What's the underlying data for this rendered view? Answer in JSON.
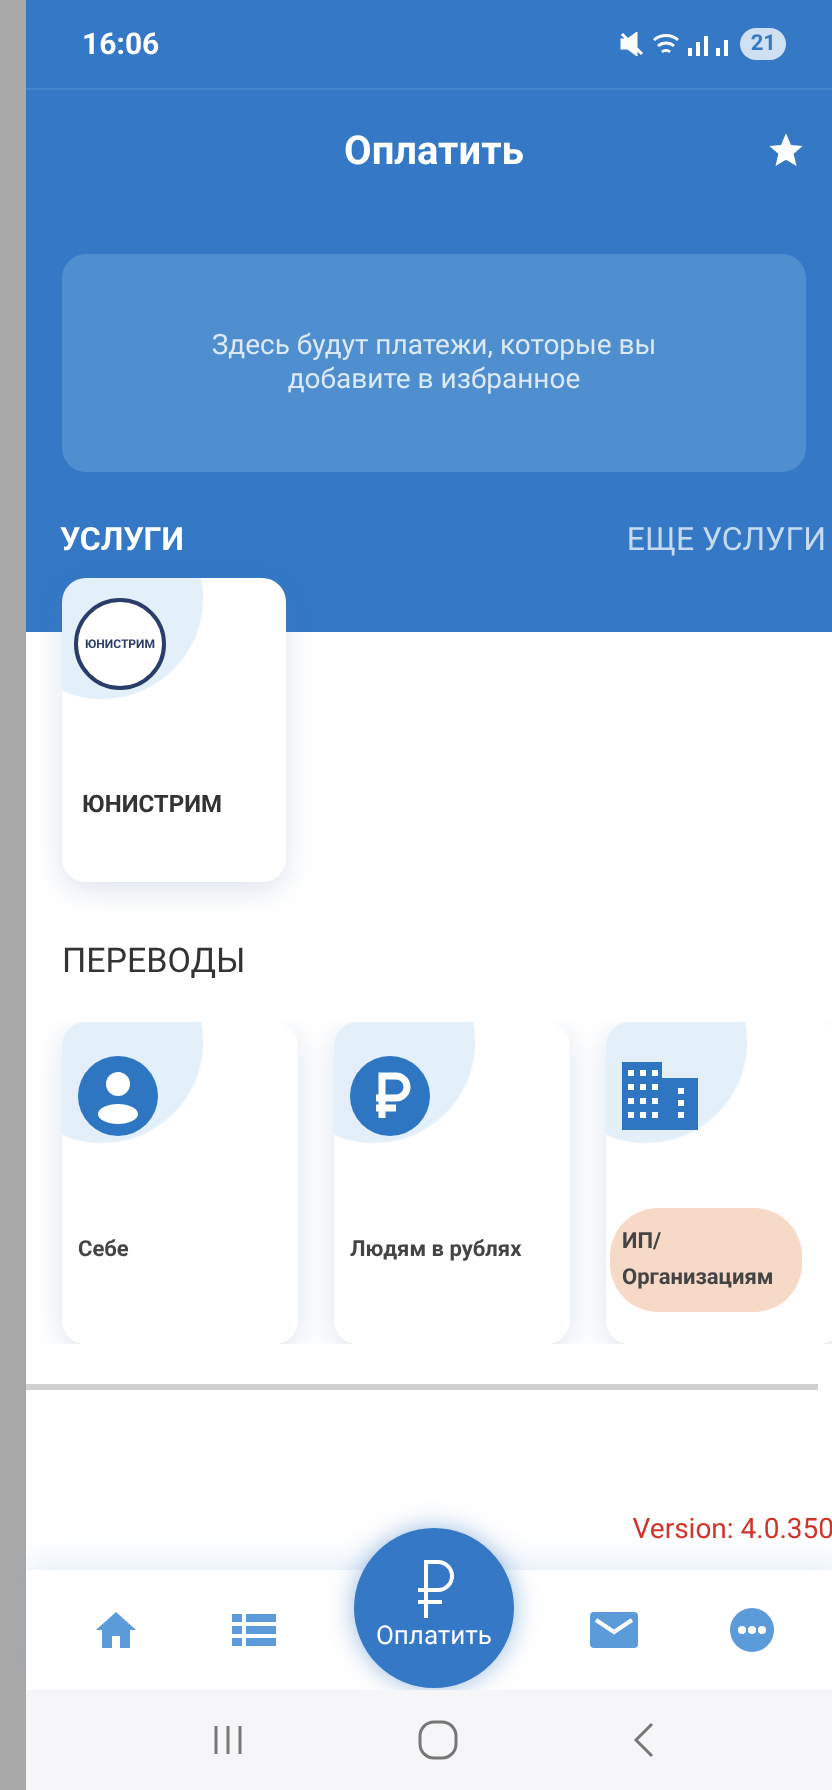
{
  "status_bar": {
    "time": "16:06",
    "battery": "21"
  },
  "header": {
    "title": "Оплатить"
  },
  "favorites": {
    "empty_text": "Здесь будут платежи, которые вы добавите в избранное"
  },
  "services": {
    "title": "УСЛУГИ",
    "more_link": "ЕЩЕ УСЛУГИ",
    "items": [
      {
        "label": "ЮНИСТРИМ",
        "logo_text": "ЮНИСТРИМ"
      }
    ]
  },
  "transfers": {
    "title": "ПЕРЕВОДЫ",
    "items": [
      {
        "kind": "person",
        "label": "Себе",
        "pressed": false
      },
      {
        "kind": "ruble",
        "label": "Людям в рублях",
        "pressed": false
      },
      {
        "kind": "building",
        "label": "ИП/ Организациям",
        "pressed": true
      }
    ]
  },
  "version": "Version: 4.0.350",
  "bottom_nav": {
    "items": [
      {
        "kind": "home"
      },
      {
        "kind": "list"
      },
      {
        "kind": "pay",
        "label": "Оплатить"
      },
      {
        "kind": "mail"
      },
      {
        "kind": "more"
      }
    ]
  }
}
